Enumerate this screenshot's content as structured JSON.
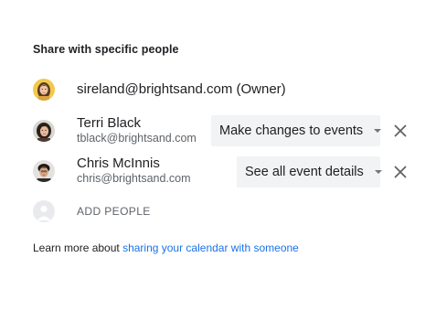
{
  "section": {
    "title": "Share with specific people"
  },
  "owner": {
    "label": "sireland@brightsand.com (Owner)",
    "avatar_icon": "owner-avatar-photo"
  },
  "people": [
    {
      "name": "Terri Black",
      "email": "tblack@brightsand.com",
      "permission": "Make changes to events",
      "avatar_icon": "terri-avatar-photo",
      "remove_icon": "close-icon"
    },
    {
      "name": "Chris McInnis",
      "email": "chris@brightsand.com",
      "permission": "See all event details",
      "avatar_icon": "chris-avatar-photo",
      "remove_icon": "close-icon"
    }
  ],
  "add_people": {
    "label": "ADD PEOPLE",
    "icon": "person-placeholder-icon"
  },
  "footer": {
    "text": "Learn more about ",
    "link": "sharing your calendar with someone"
  },
  "colors": {
    "link": "#1a73e8",
    "select_bg": "#f1f3f4",
    "text_primary": "#202124",
    "text_secondary": "#5f6368"
  }
}
